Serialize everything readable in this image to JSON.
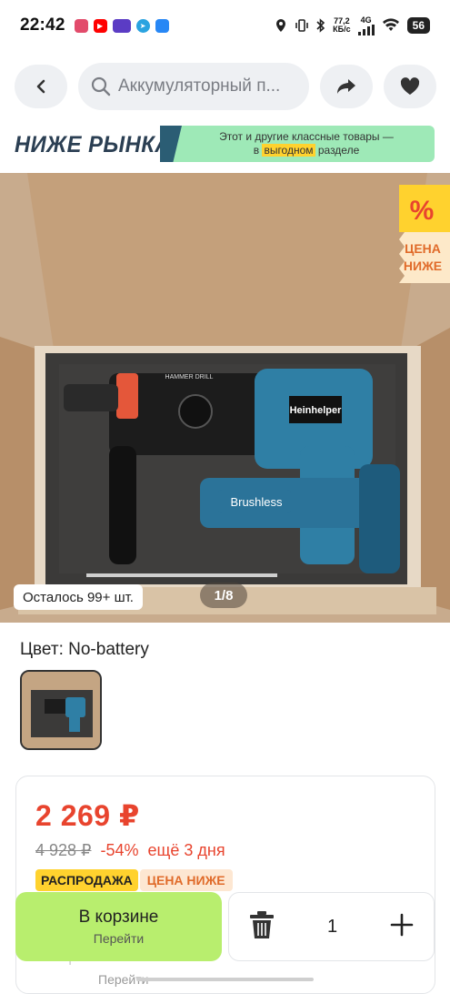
{
  "status_bar": {
    "time": "22:42",
    "network_speed_value": "77,2",
    "network_speed_unit": "КБ/с",
    "network_type": "4G",
    "battery": "56"
  },
  "search": {
    "placeholder": "Аккумуляторный п..."
  },
  "promo": {
    "logo_text": "НИЖЕ РЫНКА",
    "banner_line1": "Этот и другие классные товары —",
    "banner_line2_prefix": "в ",
    "banner_line2_highlight": "выгодном",
    "banner_line2_suffix": " разделе"
  },
  "gallery": {
    "stock_text": "Осталось 99+ шт.",
    "pager": "1/8",
    "badge_percent": "%",
    "badge_line1": "ЦЕНА",
    "badge_line2": "НИЖЕ",
    "product_brand_label": "Heinhelper",
    "product_model_label": "Brushless",
    "product_type_label": "HAMMER DRILL"
  },
  "variant": {
    "color_label": "Цвет: No-battery"
  },
  "pricing": {
    "price": "2 269 ₽",
    "old_price": "4 928 ₽",
    "discount": "-54%",
    "days_left": "ещё 3 дня",
    "tag_sale": "РАСПРОДАЖА",
    "tag_lower": "ЦЕНА НИЖЕ"
  },
  "cart": {
    "in_cart_label": "В корзине",
    "go_label": "Перейти",
    "quantity": "1"
  },
  "colors": {
    "price_red": "#e8442e",
    "cart_green": "#b8ee6e",
    "promo_green": "#9ee9b7",
    "sale_yellow": "#ffd22e"
  }
}
